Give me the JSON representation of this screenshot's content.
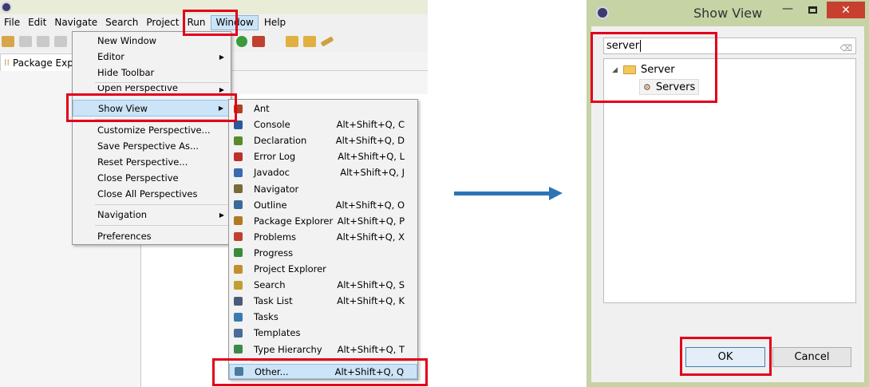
{
  "eclipse": {
    "menubar": [
      "File",
      "Edit",
      "Navigate",
      "Search",
      "Project",
      "Run",
      "Window",
      "Help"
    ],
    "active_menu": "Window",
    "package_explorer_tab": "Package Explo",
    "window_menu": [
      {
        "label": "New Window",
        "submenu": false
      },
      {
        "label": "Editor",
        "submenu": true
      },
      {
        "label": "Hide Toolbar",
        "submenu": false
      },
      {
        "label": "Open Perspective",
        "submenu": true
      },
      {
        "label": "Show View",
        "submenu": true
      },
      {
        "label": "Customize Perspective...",
        "submenu": false
      },
      {
        "label": "Save Perspective As...",
        "submenu": false
      },
      {
        "label": "Reset Perspective...",
        "submenu": false
      },
      {
        "label": "Close Perspective",
        "submenu": false
      },
      {
        "label": "Close All Perspectives",
        "submenu": false
      },
      {
        "label": "Navigation",
        "submenu": true
      },
      {
        "label": "Preferences",
        "submenu": false
      }
    ],
    "show_view_menu": [
      {
        "label": "Ant",
        "shortcut": "",
        "icon": "ant-icon",
        "color": "#b04020"
      },
      {
        "label": "Console",
        "shortcut": "Alt+Shift+Q, C",
        "icon": "console-icon",
        "color": "#2a5a9a"
      },
      {
        "label": "Declaration",
        "shortcut": "Alt+Shift+Q, D",
        "icon": "declaration-icon",
        "color": "#5a8a2a"
      },
      {
        "label": "Error Log",
        "shortcut": "Alt+Shift+Q, L",
        "icon": "error-log-icon",
        "color": "#c0302a"
      },
      {
        "label": "Javadoc",
        "shortcut": "Alt+Shift+Q, J",
        "icon": "javadoc-icon",
        "color": "#3a6ab0"
      },
      {
        "label": "Navigator",
        "shortcut": "",
        "icon": "navigator-icon",
        "color": "#7a6a3a"
      },
      {
        "label": "Outline",
        "shortcut": "Alt+Shift+Q, O",
        "icon": "outline-icon",
        "color": "#3a6a9a"
      },
      {
        "label": "Package Explorer",
        "shortcut": "Alt+Shift+Q, P",
        "icon": "package-explorer-icon",
        "color": "#b07a20"
      },
      {
        "label": "Problems",
        "shortcut": "Alt+Shift+Q, X",
        "icon": "problems-icon",
        "color": "#c04030"
      },
      {
        "label": "Progress",
        "shortcut": "",
        "icon": "progress-icon",
        "color": "#3a8a3a"
      },
      {
        "label": "Project Explorer",
        "shortcut": "",
        "icon": "project-explorer-icon",
        "color": "#c09030"
      },
      {
        "label": "Search",
        "shortcut": "Alt+Shift+Q, S",
        "icon": "search-icon",
        "color": "#c0a030"
      },
      {
        "label": "Task List",
        "shortcut": "Alt+Shift+Q, K",
        "icon": "task-list-icon",
        "color": "#4a5a7a"
      },
      {
        "label": "Tasks",
        "shortcut": "",
        "icon": "tasks-icon",
        "color": "#3a7ab0"
      },
      {
        "label": "Templates",
        "shortcut": "",
        "icon": "templates-icon",
        "color": "#4a6a9a"
      },
      {
        "label": "Type Hierarchy",
        "shortcut": "Alt+Shift+Q, T",
        "icon": "type-hierarchy-icon",
        "color": "#3a8a4a"
      },
      {
        "label": "Other...",
        "shortcut": "Alt+Shift+Q, Q",
        "icon": "other-icon",
        "color": "#4a7aa0"
      }
    ]
  },
  "dialog": {
    "title": "Show View",
    "filter_value": "server",
    "tree": {
      "category": "Server",
      "item": "Servers"
    },
    "ok_label": "OK",
    "cancel_label": "Cancel"
  },
  "colors": {
    "highlight_box": "#e2001a",
    "arrow": "#2e74b5",
    "dialog_frame": "#c5d3a5",
    "close_button": "#c7402f"
  }
}
